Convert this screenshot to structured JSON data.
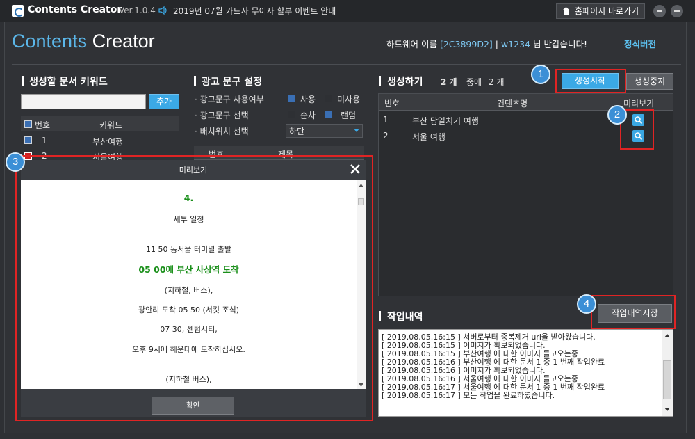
{
  "titlebar": {
    "app_title": "Contents Creator",
    "version": "Ver.1.0.4",
    "notice": "2019년 07월 카드사 무이자 할부 이벤트 안내",
    "home_button": "홈페이지 바로가기"
  },
  "header": {
    "brand_part1": "Contents",
    "brand_part2": " Creator",
    "hw_prefix": "하드웨어 이름 ",
    "hw_id": "[2C3899D2]",
    "hw_sep": " | ",
    "user": "w1234",
    "hw_suffix": " 님 반갑습니다!",
    "edition": "정식버전"
  },
  "keywords": {
    "title": "생성할 문서 키워드",
    "add_button": "추가",
    "col_num": "번호",
    "col_keyword": "키워드",
    "rows": [
      {
        "num": "1",
        "keyword": "부산여행"
      },
      {
        "num": "2",
        "keyword": "서울여행"
      }
    ]
  },
  "adcopy": {
    "title": "광고 문구 설정",
    "use_label": "· 광고문구 사용여부",
    "use_on": "사용",
    "use_off": "미사용",
    "select_label": "· 광고문구 선택",
    "order_seq": "순차",
    "order_random": "랜덤",
    "position_label": "· 배치위치 선택",
    "position_value": "하단",
    "col_num": "번호",
    "col_title": "제목"
  },
  "generate": {
    "title": "생성하기",
    "count": "2 개",
    "mid": "중에",
    "done": "2 개",
    "start_button": "생성시작",
    "stop_button": "생성중지",
    "col_num": "번호",
    "col_title": "컨텐츠명",
    "col_preview": "미리보기",
    "rows": [
      {
        "num": "1",
        "title": "부산 당일치기 여행"
      },
      {
        "num": "2",
        "title": "서울 여행"
      }
    ]
  },
  "worklog": {
    "title": "작업내역",
    "save_button": "작업내역저장",
    "lines": [
      "[ 2019.08.05.16:15 ] 서버로부터 중복제거 url을 받아왔습니다.",
      "[ 2019.08.05.16:15 ] 이미지가 확보되었습니다.",
      "[ 2019.08.05.16:15 ] 부산여행 에 대한 이미지 들고오는중",
      "[ 2019.08.05.16:16 ] 부산여행 에 대한 문서 1 중 1 번째 작업완료",
      "[ 2019.08.05.16:16 ] 이미지가 확보되었습니다.",
      "[ 2019.08.05.16:16 ] 서울여행 에 대한 이미지 들고오는중",
      "[ 2019.08.05.16:17 ] 서울여행 에 대한 문서 1 중 1 번째 작업완료",
      "[ 2019.08.05.16:17 ] 모든 작업을 완료하였습니다."
    ]
  },
  "preview": {
    "title": "미리보기",
    "ok_button": "확인",
    "lines": [
      "4.",
      "세부 일정",
      "11 50 동서울 터미널 출발",
      "05 00에 부산 사상역 도착",
      "(지하철, 버스),",
      "광안리 도착 05 50 (서킷 조식)",
      "07 30, 센텀시티,",
      "오후 9시에 해운대에 도착하십시오.",
      "(지하철 버스),"
    ]
  },
  "badges": [
    "1",
    "2",
    "3",
    "4"
  ],
  "colors": {
    "accent": "#3ba9e6",
    "highlight": "#e02424",
    "brand": "#5bb6e8"
  }
}
